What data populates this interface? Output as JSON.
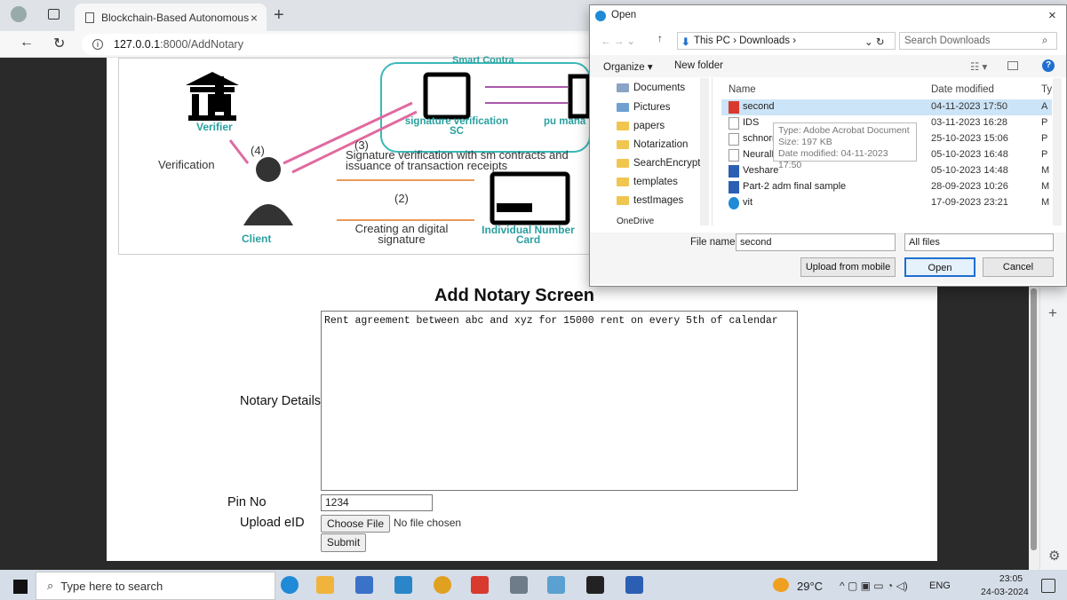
{
  "browser": {
    "tab_title": "Blockchain-Based Autonomous N",
    "tab_close": "×",
    "new_tab": "+",
    "url_host": "127.0.0.1",
    "url_path": ":8000/AddNotary"
  },
  "diagram": {
    "title_partial": "Smart Contra",
    "verifier": "Verifier",
    "client": "Client",
    "verification": "Verification",
    "step4": "(4)",
    "step3": "(3)",
    "step2": "(2)",
    "sig_sc": "signature verification SC",
    "manage": "pu mana",
    "sig_text": "Signature verification with sm contracts and issuance of transaction receipts",
    "creating": "Creating an digital signature",
    "card": "Individual Number Card"
  },
  "form": {
    "title": "Add Notary Screen",
    "notary_label": "Notary Details",
    "notary_value": "Rent agreement between abc and xyz for 15000 rent on every 5th of calendar",
    "pin_label": "Pin No",
    "pin_value": "1234",
    "upload_label": "Upload eID",
    "choose_file": "Choose File",
    "no_file": "No file chosen",
    "submit": "Submit"
  },
  "dialog": {
    "title": "Open",
    "close": "×",
    "breadcrumb": "This PC  ›  Downloads  ›",
    "search_placeholder": "Search Downloads",
    "organize": "Organize ▾",
    "new_folder": "New folder",
    "nav_items": [
      "Documents",
      "Pictures",
      "papers",
      "Notarization",
      "SearchEncryptio",
      "templates",
      "testImages",
      "OneDrive"
    ],
    "columns": {
      "name": "Name",
      "date": "Date modified",
      "type": "Ty"
    },
    "files": [
      {
        "name": "second",
        "date": "04-11-2023 17:50",
        "type": "A"
      },
      {
        "name": "IDS",
        "date": "03-11-2023 16:28",
        "type": "P"
      },
      {
        "name": "schnorr",
        "date": "25-10-2023 15:06",
        "type": "P"
      },
      {
        "name": "NeuralNetwork",
        "date": "05-10-2023 16:48",
        "type": "P"
      },
      {
        "name": "Veshare",
        "date": "05-10-2023 14:48",
        "type": "M"
      },
      {
        "name": "Part-2 adm final sample",
        "date": "28-09-2023 10:26",
        "type": "M"
      },
      {
        "name": "vit",
        "date": "17-09-2023 23:21",
        "type": "M"
      }
    ],
    "tooltip_type": "Type: Adobe Acrobat Document",
    "tooltip_size": "Size: 197 KB",
    "tooltip_date": "Date modified: 04-11-2023 17:50",
    "file_name_label": "File name:",
    "file_name_value": "second",
    "file_type": "All files",
    "upload_mobile": "Upload from mobile",
    "open": "Open",
    "cancel": "Cancel"
  },
  "taskbar": {
    "search_placeholder": "Type here to search",
    "weather": "29°C",
    "lang": "ENG",
    "time": "23:05",
    "date": "24-03-2024"
  }
}
